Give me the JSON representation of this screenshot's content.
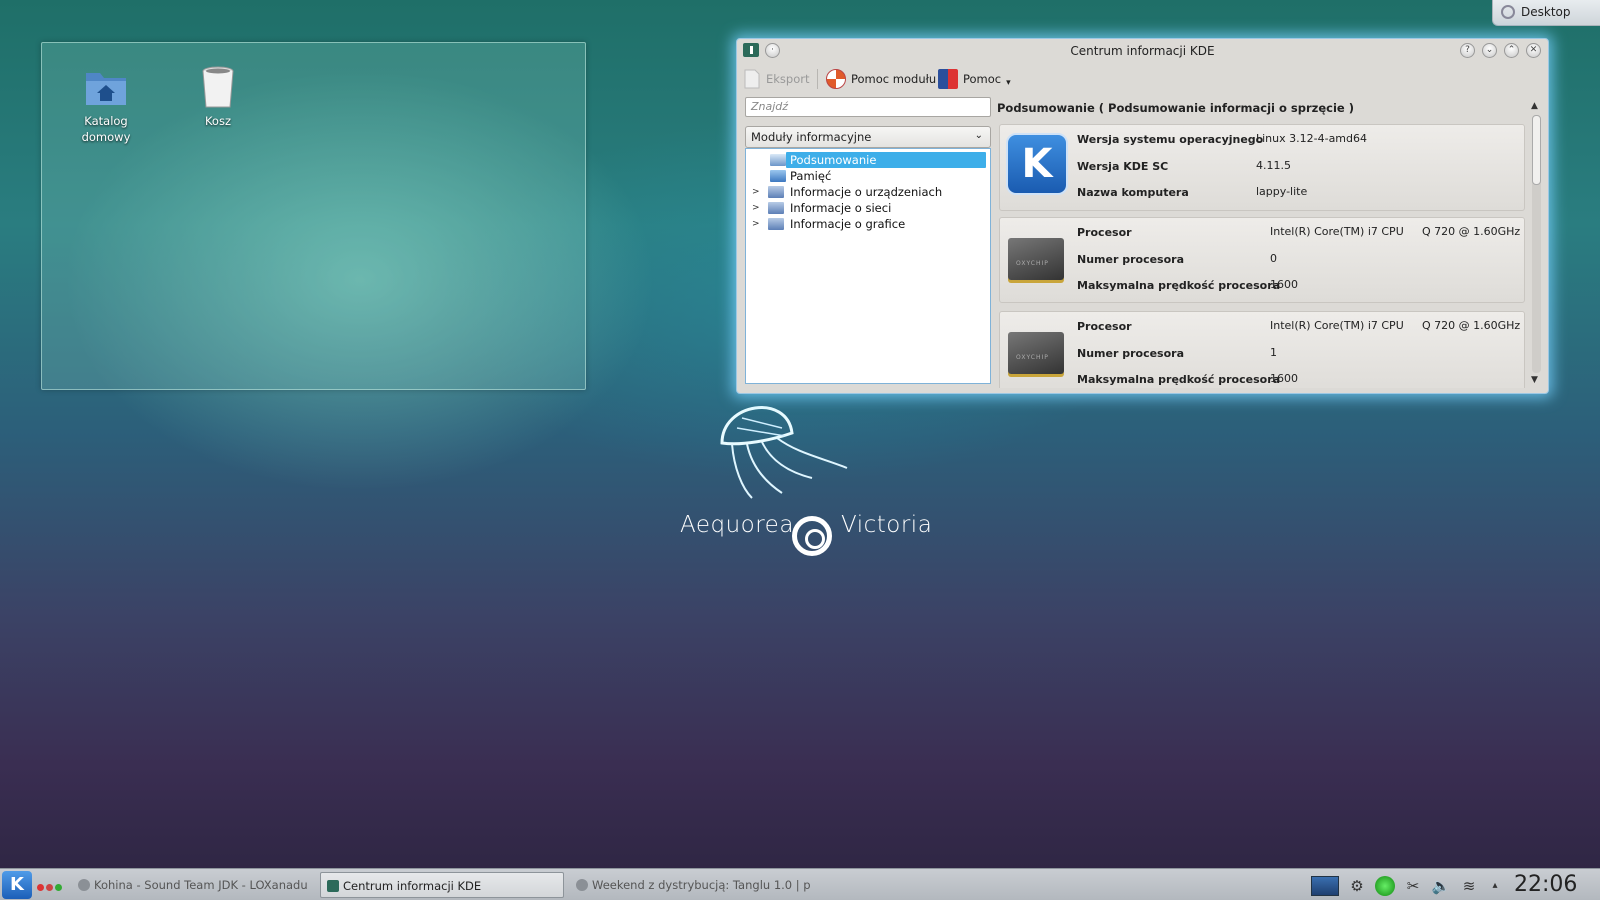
{
  "desktop": {
    "icons": [
      {
        "label": "Katalog domowy"
      },
      {
        "label": "Kosz"
      }
    ],
    "desktop_tab": "Desktop",
    "wallpaper_text_left": "Aequorea",
    "wallpaper_text_right": "Victoria"
  },
  "window": {
    "title": "Centrum informacji KDE",
    "toolbar": {
      "export": "Eksport",
      "module_help": "Pomoc modułu",
      "help": "Pomoc"
    },
    "search_placeholder": "Znajdź",
    "combo_value": "Moduły informacyjne",
    "tree": [
      {
        "label": "Podsumowanie",
        "selected": true,
        "expandable": false
      },
      {
        "label": "Pamięć",
        "selected": false,
        "expandable": false
      },
      {
        "label": "Informacje o urządzeniach",
        "selected": false,
        "expandable": true
      },
      {
        "label": "Informacje o sieci",
        "selected": false,
        "expandable": true
      },
      {
        "label": "Informacje o grafice",
        "selected": false,
        "expandable": true
      }
    ],
    "heading": "Podsumowanie  ( Podsumowanie informacji o sprzęcie )",
    "system": {
      "os_label": "Wersja systemu operacyjnego",
      "os_value": "Linux 3.12-4-amd64",
      "kde_label": "Wersja KDE SC",
      "kde_value": "4.11.5",
      "host_label": "Nazwa komputera",
      "host_value": "lappy-lite"
    },
    "cpus": [
      {
        "proc_label": "Procesor",
        "proc_value": "Intel(R) Core(TM) i7 CPU",
        "proc_model": "Q 720  @ 1.60GHz",
        "num_label": "Numer procesora",
        "num_value": "0",
        "speed_label": "Maksymalna prędkość procesora",
        "speed_value": "1600",
        "chip_text": "OXYCHIP"
      },
      {
        "proc_label": "Procesor",
        "proc_value": "Intel(R) Core(TM) i7 CPU",
        "proc_model": "Q 720  @ 1.60GHz",
        "num_label": "Numer procesora",
        "num_value": "1",
        "speed_label": "Maksymalna prędkość procesora",
        "speed_value": "1600",
        "chip_text": "OXYCHIP"
      }
    ]
  },
  "taskbar": {
    "tasks": [
      {
        "label": "Kohina - Sound Team JDK - LOXanadu"
      },
      {
        "label": "Centrum informacji KDE"
      },
      {
        "label": "Weekend z dystrybucją: Tanglu 1.0 | p"
      }
    ],
    "clock": "22:06"
  }
}
